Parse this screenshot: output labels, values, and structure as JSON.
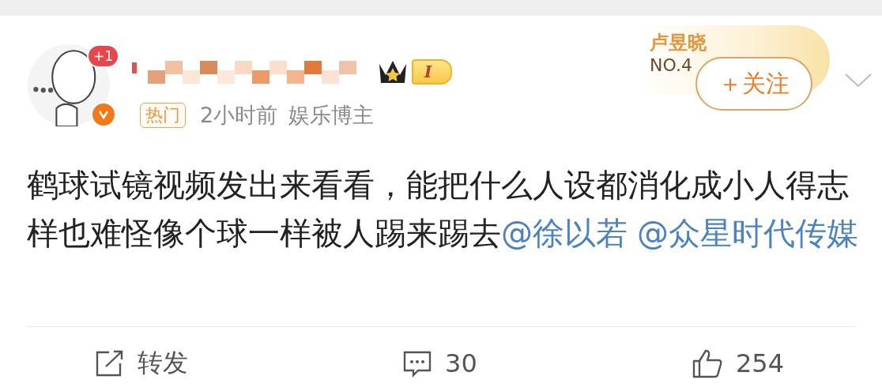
{
  "post": {
    "avatar_badge": "+1",
    "verified": true,
    "level_badge": "I",
    "tags": [
      {
        "label": "热门"
      }
    ],
    "time": "2小时前",
    "category": "娱乐博主",
    "fan_badge": {
      "name": "卢昱晓",
      "rank": "NO.4"
    },
    "follow_button": "＋关注",
    "text": "鹤球试镜视频发出来看看，能把什么人设都消化成小人得志样也难怪像个球一样被人踢来踢去",
    "mentions": [
      "@徐以若",
      "@众星时代传媒"
    ]
  },
  "actions": [
    {
      "kind": "repost",
      "label": "转发"
    },
    {
      "kind": "comment",
      "label": "30"
    },
    {
      "kind": "like",
      "label": "254"
    }
  ]
}
